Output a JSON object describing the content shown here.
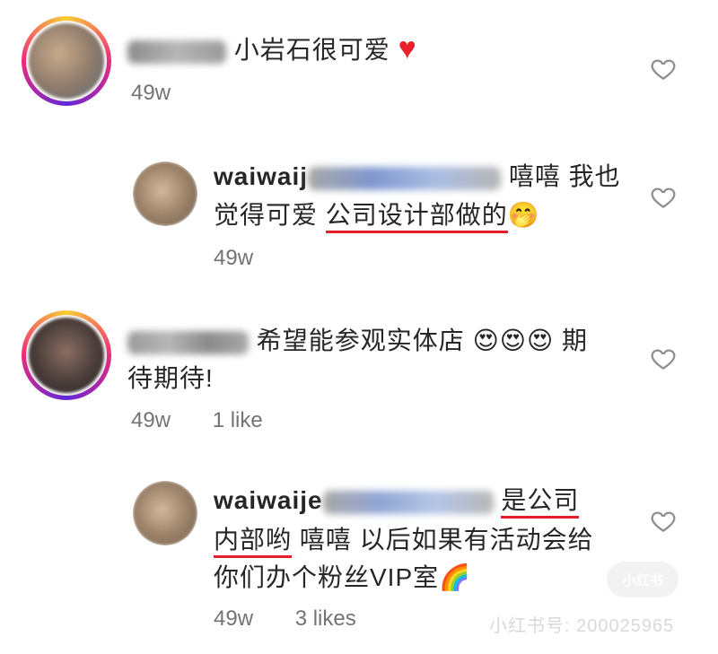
{
  "comments": [
    {
      "text_line1": "小岩石很可爱",
      "emoji": "♥",
      "time": "49w",
      "likes": ""
    },
    {
      "username_prefix": "waiwaij",
      "text_line1_end": "嘻嘻 我也",
      "text_line2_plain": "觉得可爱",
      "text_line2_underlined": "公司设计部做的",
      "emoji": "🤭",
      "time": "49w",
      "likes": ""
    },
    {
      "text_line1": "希望能参观实体店",
      "emoji_group": "😍😍😍",
      "text_line1_end": "期",
      "text_line2": "待期待!",
      "time": "49w",
      "likes": "1 like"
    },
    {
      "username_prefix": "waiwaije",
      "text_line1_underlined": "是公司",
      "text_line2_underlined": "内部哟",
      "text_line2_plain": "嘻嘻 以后如果有活动会给",
      "text_line3": "你们办个粉丝VIP室",
      "emoji": "🌈",
      "time": "49w",
      "likes": "3 likes"
    }
  ],
  "watermark": {
    "logo": "小红书",
    "text": "小红书号: 200025965"
  },
  "icons": {
    "like": "heart-outline-icon"
  },
  "colors": {
    "underline": "#e0202a",
    "meta": "#737373",
    "heart_emoji": "#e8202a"
  }
}
